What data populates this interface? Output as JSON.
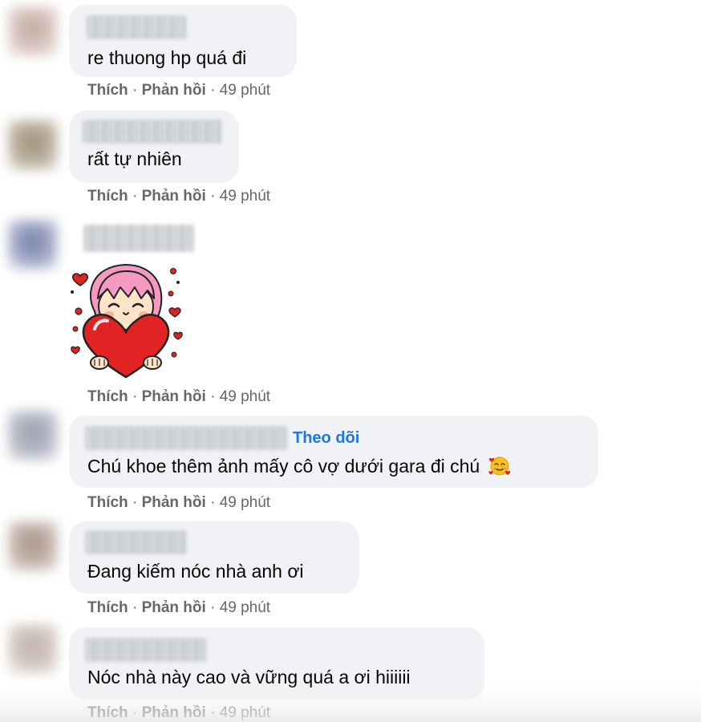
{
  "comments": [
    {
      "text": "re thuong hp quá đi",
      "meta": {
        "like": "Thích",
        "sep1": " · ",
        "reply": "Phản hồi",
        "sep2": " · ",
        "time": "49 phút"
      },
      "avatar_color": "#b79a8e"
    },
    {
      "text": "rất tự nhiên",
      "meta": {
        "like": "Thích",
        "sep1": " · ",
        "reply": "Phản hồi",
        "sep2": " · ",
        "time": "49 phút"
      },
      "avatar_color": "#8f7d63"
    },
    {
      "sticker": "pink-hair-girl-holding-heart-sticker",
      "meta": {
        "like": "Thích",
        "sep1": " · ",
        "reply": "Phản hồi",
        "sep2": " · ",
        "time": "49 phút"
      },
      "avatar_color": "#5f6b9a"
    },
    {
      "follow_label": "Theo dõi",
      "text": "Chú khoe thêm ảnh mấy cô vợ dưới gara đi chú",
      "emoji": "smiling-face-with-hearts-emoji",
      "meta": {
        "like": "Thích",
        "sep1": " · ",
        "reply": "Phản hồi",
        "sep2": " · ",
        "time": "49 phút"
      },
      "avatar_color": "#8a8ea3"
    },
    {
      "text": "Đang kiếm nóc nhà anh ơi",
      "meta": {
        "like": "Thích",
        "sep1": " · ",
        "reply": "Phản hồi",
        "sep2": " · ",
        "time": "49 phút"
      },
      "avatar_color": "#9a8275"
    },
    {
      "text": "Nóc nhà này cao và vững quá a ơi hiiiiii",
      "meta": {
        "like": "Thích",
        "sep1": " · ",
        "reply": "Phản hồi",
        "sep2": " · ",
        "time": "49 phút"
      },
      "avatar_color": "#b5a29a"
    }
  ],
  "colors": {
    "bubble": "#f0f2f5",
    "meta": "#65676b",
    "link": "#1877f2",
    "heart": "#e02424",
    "hair": "#f49ac1"
  }
}
